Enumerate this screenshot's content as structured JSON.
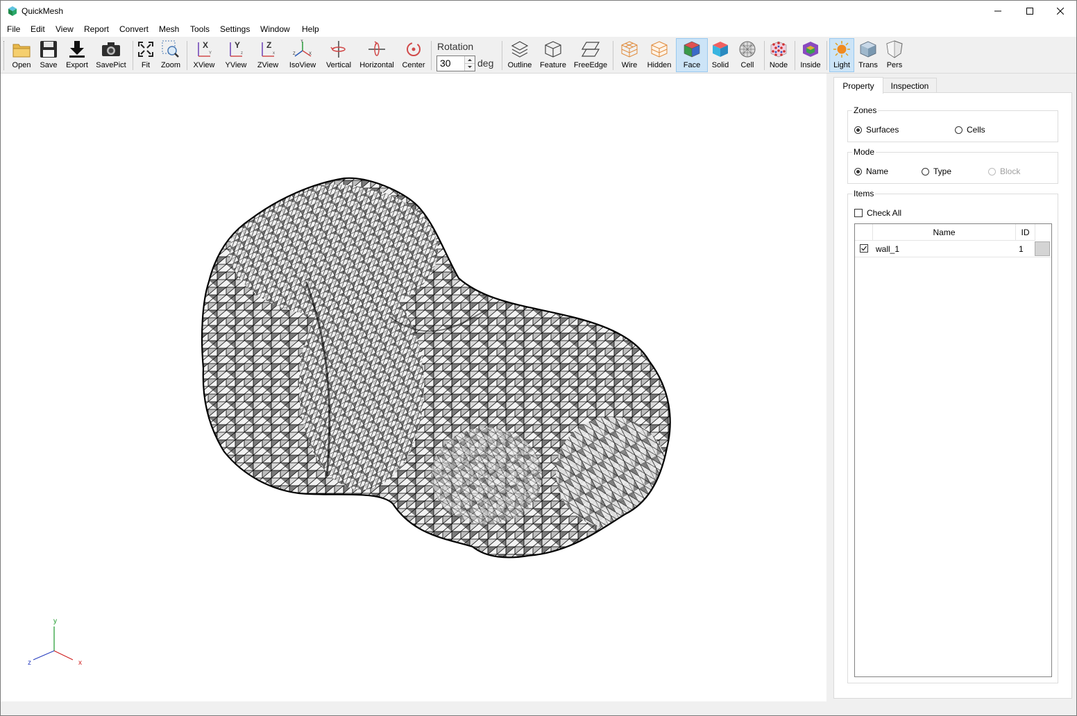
{
  "window": {
    "title": "QuickMesh",
    "controls": [
      "minimize",
      "maximize",
      "close"
    ]
  },
  "menu": [
    "File",
    "Edit",
    "View",
    "Report",
    "Convert",
    "Mesh",
    "Tools",
    "Settings",
    "Window",
    "Help"
  ],
  "toolbar": {
    "open": "Open",
    "save": "Save",
    "export": "Export",
    "savepict": "SavePict",
    "fit": "Fit",
    "zoom": "Zoom",
    "xview": "XView",
    "yview": "YView",
    "zview": "ZView",
    "isoview": "IsoView",
    "vertical": "Vertical",
    "horizontal": "Horizontal",
    "center": "Center",
    "rotation_label": "Rotation",
    "rotation_value": "30",
    "rotation_unit": "deg",
    "outline": "Outline",
    "feature": "Feature",
    "freeedge": "FreeEdge",
    "wire": "Wire",
    "hidden": "Hidden",
    "face": "Face",
    "solid": "Solid",
    "cell": "Cell",
    "node": "Node",
    "inside": "Inside",
    "light": "Light",
    "trans": "Trans",
    "pers": "Pers",
    "active": [
      "Face",
      "Light"
    ]
  },
  "viewport": {
    "axes": {
      "y": "y",
      "z": "z",
      "x": "x"
    },
    "colors": {
      "face_dark": "#7a7a7a",
      "face_light": "#f2f2f2",
      "edge": "#000000"
    }
  },
  "panel": {
    "tabs": [
      "Property",
      "Inspection"
    ],
    "active_tab": "Property",
    "zones": {
      "title": "Zones",
      "options": [
        "Surfaces",
        "Cells"
      ],
      "selected": "Surfaces"
    },
    "mode": {
      "title": "Mode",
      "options": [
        "Name",
        "Type",
        "Block"
      ],
      "selected": "Name",
      "disabled": [
        "Block"
      ]
    },
    "items": {
      "title": "Items",
      "check_all": "Check All",
      "columns": [
        "Name",
        "ID"
      ],
      "rows": [
        {
          "checked": true,
          "name": "wall_1",
          "id": "1"
        }
      ]
    }
  }
}
